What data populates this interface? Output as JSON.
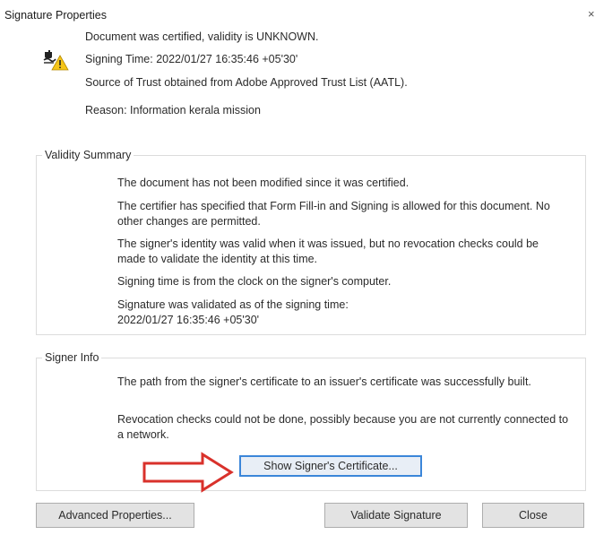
{
  "window": {
    "title": "Signature Properties",
    "close_glyph": "×"
  },
  "header": {
    "icon": "signature-warning-icon",
    "status": "Document was certified, validity is UNKNOWN.",
    "signing_time": "Signing Time:  2022/01/27 16:35:46 +05'30'",
    "source_of_trust": "Source of Trust obtained from Adobe Approved Trust List (AATL).",
    "reason": "Reason:  Information kerala mission"
  },
  "validity_summary": {
    "label": "Validity Summary",
    "items": [
      "The document has not been modified since it was certified.",
      "The certifier has specified that Form Fill-in and Signing is allowed for this document. No other changes are permitted.",
      "The signer's identity was valid when it was issued, but no revocation checks could be made to validate the identity at this time.",
      "Signing time is from the clock on the signer's computer.",
      "Signature was validated as of the signing time:\n2022/01/27 16:35:46 +05'30'"
    ]
  },
  "signer_info": {
    "label": "Signer Info",
    "items": [
      "The path from the signer's certificate to an issuer's certificate was successfully built.",
      "Revocation checks could not be done, possibly because you are not currently connected to a network."
    ],
    "show_certificate_label": "Show Signer's Certificate...",
    "annotation_arrow_color": "#d9312b"
  },
  "buttons": {
    "advanced_properties": "Advanced Properties...",
    "validate_signature": "Validate Signature",
    "close": "Close"
  },
  "colors": {
    "focus_border": "#3b86d9",
    "warning_yellow": "#f5c518"
  }
}
